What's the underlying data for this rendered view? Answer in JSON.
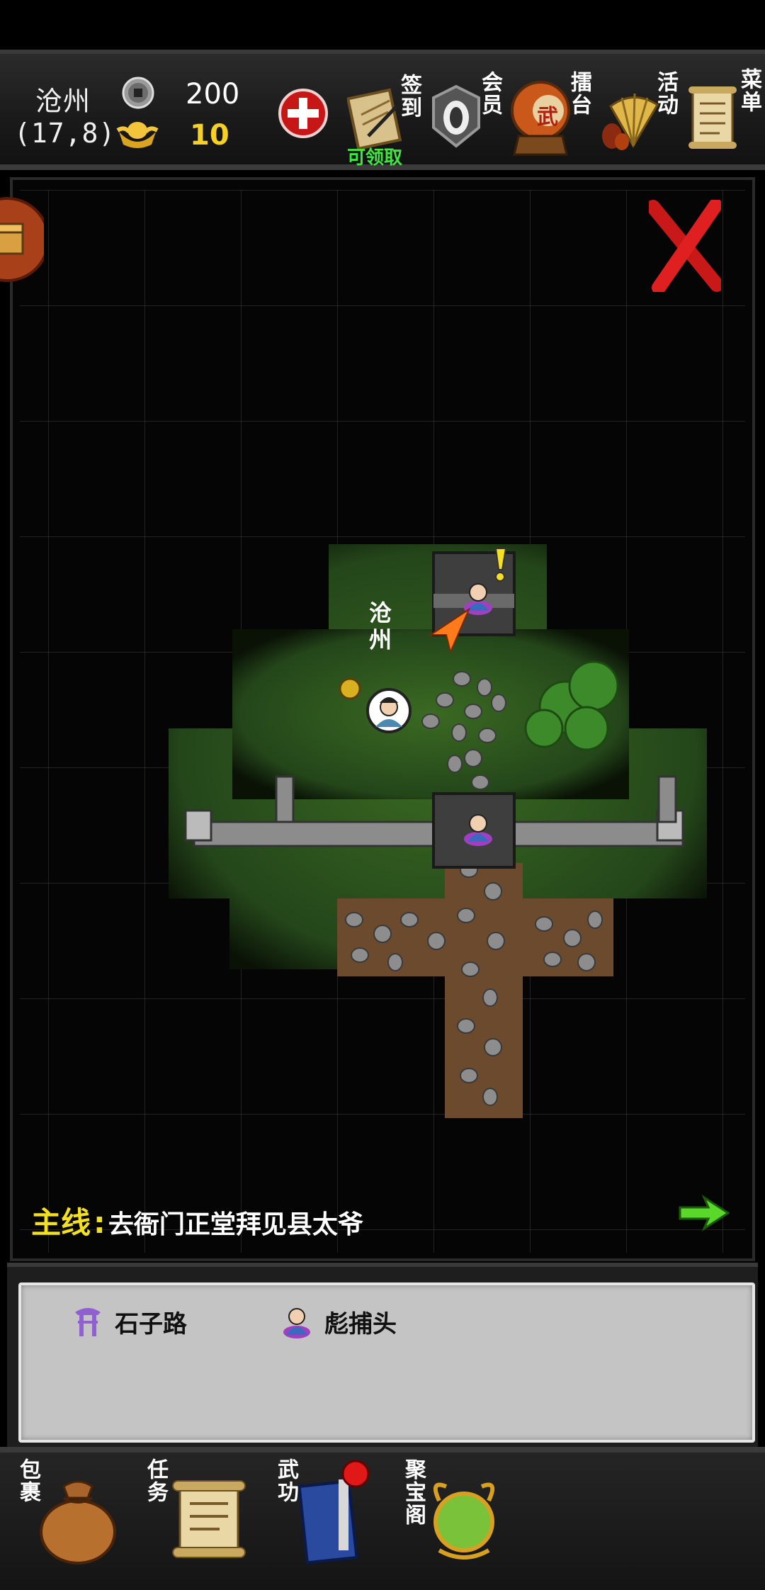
{
  "header": {
    "location_name": "沧州",
    "coordinates": "(17,8)",
    "copper_coins": "200",
    "gold_ingots": "10",
    "buttons": [
      {
        "label": "签到",
        "badge": "可领取"
      },
      {
        "label": "会员"
      },
      {
        "label": "擂台",
        "emblem": "武"
      },
      {
        "label": "活动"
      },
      {
        "label": "菜单"
      }
    ]
  },
  "map": {
    "place_label": "沧州",
    "colors": {
      "grass": "#2f5a1c",
      "dirt": "#6b4a2e",
      "stone": "#9a9a9a",
      "wall": "#8c8c8c",
      "close_x": "#d01818"
    }
  },
  "quest": {
    "label": "主线",
    "separator": ":",
    "text": "去衙门正堂拜见县太爷"
  },
  "info": {
    "items": [
      {
        "icon": "gate-icon",
        "label": "石子路"
      },
      {
        "icon": "npc-icon",
        "label": "彪捕头"
      }
    ]
  },
  "bottom_nav": [
    {
      "label": "包裹",
      "icon": "bag-icon"
    },
    {
      "label": "任务",
      "icon": "scroll-icon"
    },
    {
      "label": "武功",
      "icon": "book-icon"
    },
    {
      "label": "聚宝阁",
      "icon": "treasure-icon"
    }
  ]
}
